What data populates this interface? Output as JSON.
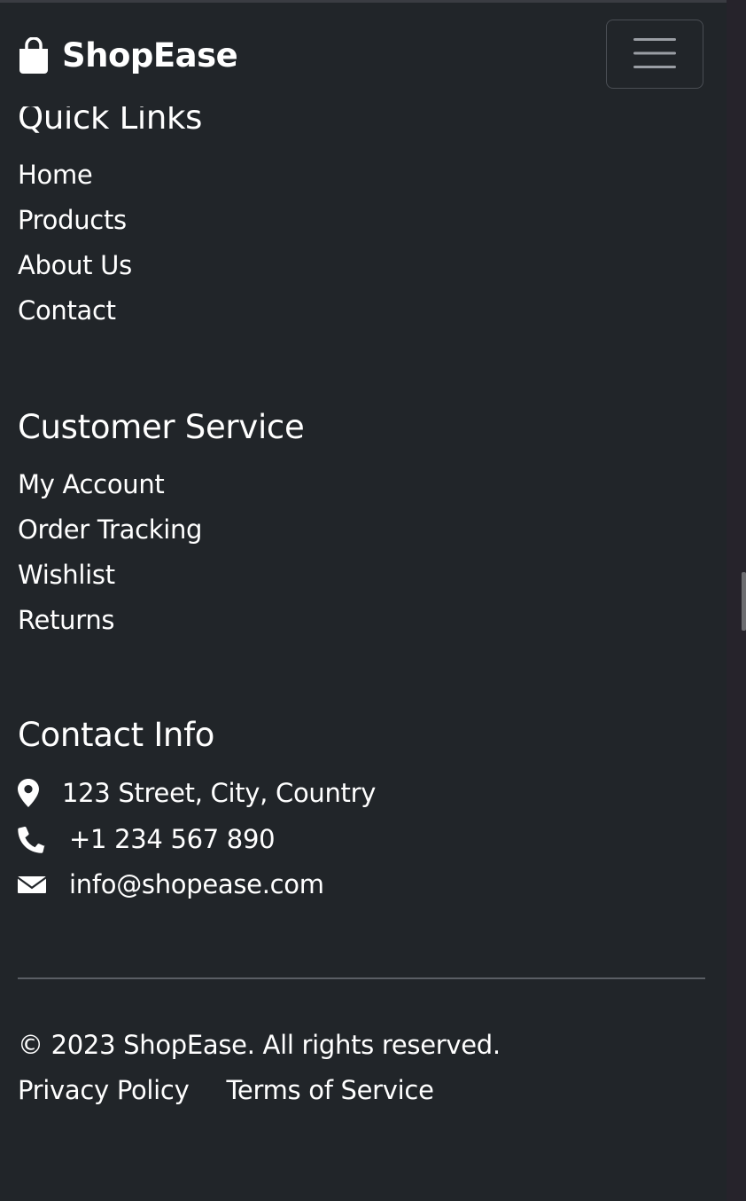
{
  "navbar": {
    "brand_name": "ShopEase",
    "brand_icon": "shopping-bag-icon",
    "toggler_icon": "hamburger-menu-icon"
  },
  "quick_links": {
    "title": "Quick Links",
    "items": [
      "Home",
      "Products",
      "About Us",
      "Contact"
    ]
  },
  "customer_service": {
    "title": "Customer Service",
    "items": [
      "My Account",
      "Order Tracking",
      "Wishlist",
      "Returns"
    ]
  },
  "contact_info": {
    "title": "Contact Info",
    "address": "123 Street, City, Country",
    "phone": "+1 234 567 890",
    "email": "info@shopease.com",
    "icons": [
      "map-marker-icon",
      "phone-icon",
      "envelope-icon"
    ]
  },
  "footer": {
    "copyright": "© 2023 ShopEase. All rights reserved.",
    "privacy_label": "Privacy Policy",
    "terms_label": "Terms of Service"
  },
  "colors": {
    "background": "#212529",
    "text": "#ffffff",
    "divider": "#5a5e64"
  }
}
